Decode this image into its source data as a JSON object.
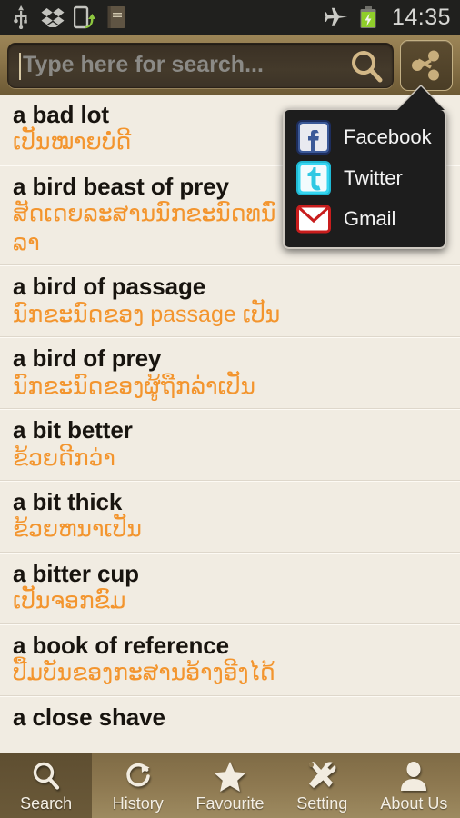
{
  "status_bar": {
    "time": "14:35",
    "left_icons": [
      {
        "name": "usb-icon",
        "label": "USB"
      },
      {
        "name": "dropbox-icon",
        "label": "Dropbox"
      },
      {
        "name": "file-transfer-icon",
        "label": "File transfer"
      },
      {
        "name": "dictionary-app-icon",
        "label": "Dictionary"
      }
    ],
    "right_icons": [
      {
        "name": "airplane-mode-icon",
        "label": "Airplane mode"
      },
      {
        "name": "battery-charging-icon",
        "label": "Battery charging"
      }
    ]
  },
  "toolbar": {
    "search_placeholder": "Type here for search...",
    "search_value": "",
    "search_icon": "search-icon",
    "share_icon": "share-icon"
  },
  "share_popup": {
    "visible": true,
    "items": [
      {
        "label": "Facebook",
        "icon": "facebook-icon"
      },
      {
        "label": "Twitter",
        "icon": "twitter-icon"
      },
      {
        "label": "Gmail",
        "icon": "gmail-icon"
      }
    ]
  },
  "entries": [
    {
      "term": "a bad lot",
      "translation": "ເປັນໝາຍບໍ່ດີ"
    },
    {
      "term": "a bird beast of prey",
      "translation": "ສັດເດຍລະສານນົກຂະນົດທນົ່ລາ"
    },
    {
      "term": "a bird of passage",
      "translation": "ນົກຂະນົດຂອງ passage ເປັນ"
    },
    {
      "term": "a bird of prey",
      "translation": "ນົກຂະນົດຂອງຜູ້ຖືກລ່າເປັນ"
    },
    {
      "term": "a bit better",
      "translation": "ຂ້ວຍດີກວ່າ"
    },
    {
      "term": "a bit thick",
      "translation": "ຂ້ວຍຫນາເປັນ"
    },
    {
      "term": "a bitter cup",
      "translation": "ເປັນຈອກຂົມ"
    },
    {
      "term": "a book of reference",
      "translation": "ປື້ມບັນຂອງກະສານອ້າງອີງໄດ້"
    },
    {
      "term": "a close shave",
      "translation": ""
    }
  ],
  "tabs": [
    {
      "label": "Search",
      "icon": "search-icon",
      "active": true
    },
    {
      "label": "History",
      "icon": "history-icon",
      "active": false
    },
    {
      "label": "Favourite",
      "icon": "star-icon",
      "active": false
    },
    {
      "label": "Setting",
      "icon": "tools-icon",
      "active": false
    },
    {
      "label": "About Us",
      "icon": "person-icon",
      "active": false
    }
  ],
  "colors": {
    "accent_orange": "#F3952E",
    "page_background": "#F1ECE2",
    "toolbar_brown": "#8a7449",
    "status_bar": "#20201e"
  }
}
